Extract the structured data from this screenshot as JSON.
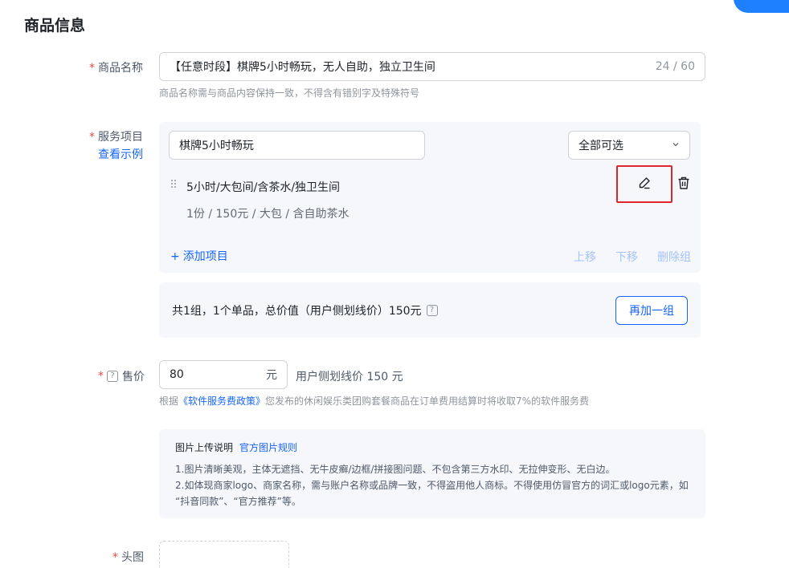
{
  "section": {
    "title": "商品信息"
  },
  "product_name": {
    "required_mark": "*",
    "label": "商品名称",
    "value": "【任意时段】棋牌5小时畅玩，无人自助，独立卫生间",
    "count": "24 / 60",
    "hint": "商品名称需与商品内容保持一致，不得含有错别字及特殊符号"
  },
  "service": {
    "required_mark": "*",
    "label": "服务项目",
    "example_link": "查看示例",
    "group_name": "棋牌5小时畅玩",
    "select_value": "全部可选",
    "item": {
      "title": "5小时/大包间/含茶水/独卫生间",
      "detail": "1份 / 150元 / 大包 / 含自助茶水"
    },
    "add_item": "添加项目",
    "move_up": "上移",
    "move_down": "下移",
    "delete_group": "删除组"
  },
  "summary": {
    "text": "共1组，1个单品，总价值（用户侧划线价）150元",
    "help": "?",
    "add_group": "再加一组"
  },
  "price": {
    "required_mark": "*",
    "help": "?",
    "label": "售价",
    "value": "80",
    "unit": "元",
    "side_text": "用户侧划线价 150 元",
    "hint_prefix": "根据",
    "hint_link": "《软件服务费政策》",
    "hint_suffix": "您发布的休闲娱乐类团购套餐商品在订单费用结算时将收取7%的软件服务费"
  },
  "upload": {
    "title": "图片上传说明",
    "rules_link": "官方图片规则",
    "line1": "1.图片清晰美观，主体无遮挡、无牛皮癣/边框/拼接图问题、不包含第三方水印、无拉伸变形、无白边。",
    "line2": "2.如体现商家logo、商家名称，需与账户名称或品牌一致，不得盗用他人商标。不得使用仿冒官方的词汇或logo元素，如",
    "line3": "“抖音同款”、“官方推荐”等。"
  },
  "bottom": {
    "required_mark": "*",
    "label": "头图"
  },
  "colors": {
    "primary": "#1664ff",
    "required": "#f54a45",
    "highlight_border": "#e0262a"
  },
  "icons": {
    "edit": "pencil-icon",
    "delete": "trash-icon",
    "drag": "drag-handle-icon",
    "select": "chevron-down-icon"
  }
}
